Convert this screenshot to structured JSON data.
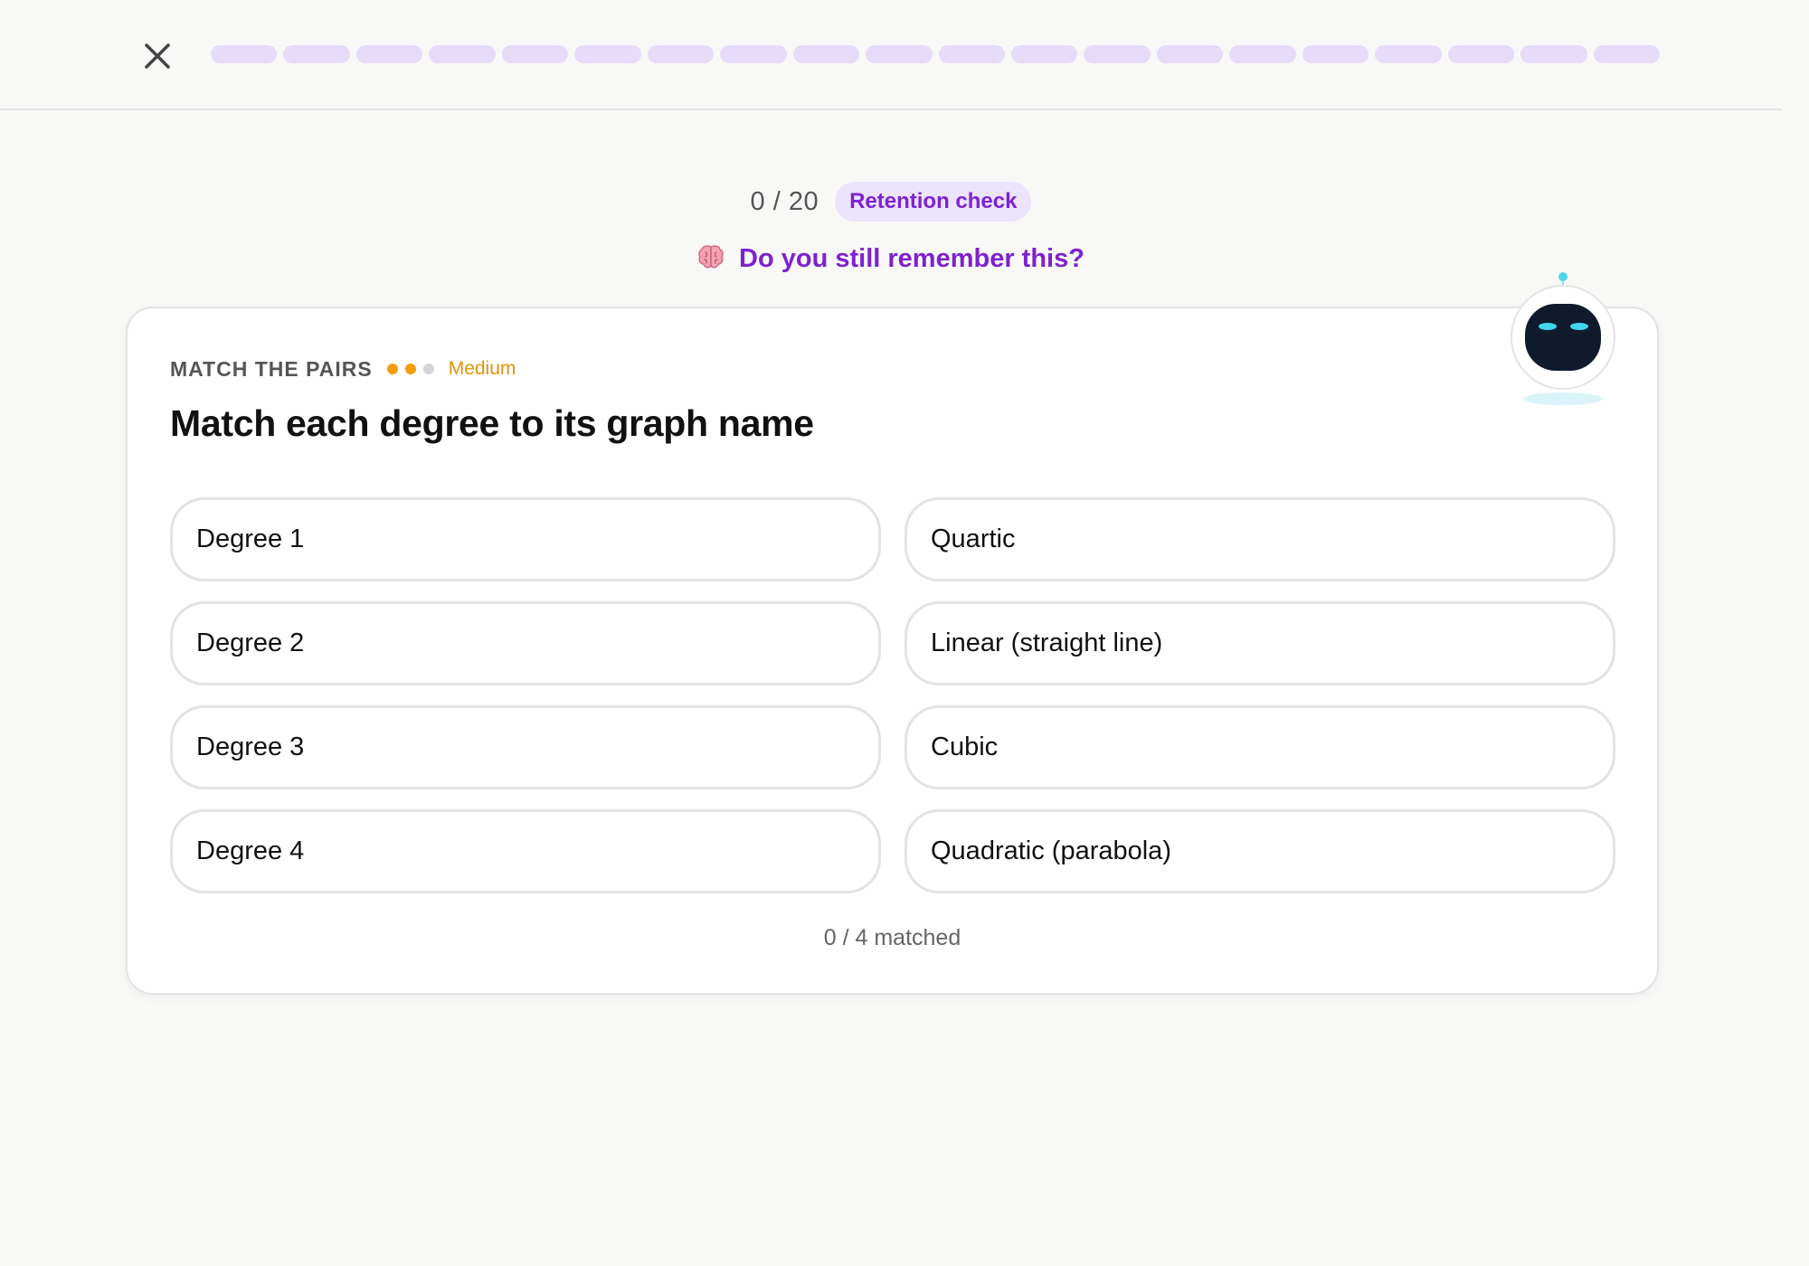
{
  "header": {
    "close_icon": "close-icon",
    "progress": {
      "total_segments": 20,
      "completed_segments": 0,
      "segment_color": "#e6dcfa"
    }
  },
  "status": {
    "counter": "0 / 20",
    "badge": "Retention check",
    "prompt_icon": "brain-emoji",
    "prompt": "Do you still remember this?"
  },
  "card": {
    "type_label": "MATCH THE PAIRS",
    "difficulty": {
      "label": "Medium",
      "level": 2,
      "max": 3,
      "color": "#f59e0b",
      "empty_color": "#d4d4d4"
    },
    "question": "Match each degree to its graph name",
    "left_items": [
      "Degree 1",
      "Degree 2",
      "Degree 3",
      "Degree 4"
    ],
    "right_items": [
      "Quartic",
      "Linear (straight line)",
      "Cubic",
      "Quadratic (parabola)"
    ],
    "matched_text": "0 / 4 matched"
  },
  "mascot": {
    "icon": "robot-mascot-icon"
  },
  "colors": {
    "accent": "#7e22ce",
    "badge_bg": "#ece3fd",
    "background": "#f8f8f7"
  }
}
